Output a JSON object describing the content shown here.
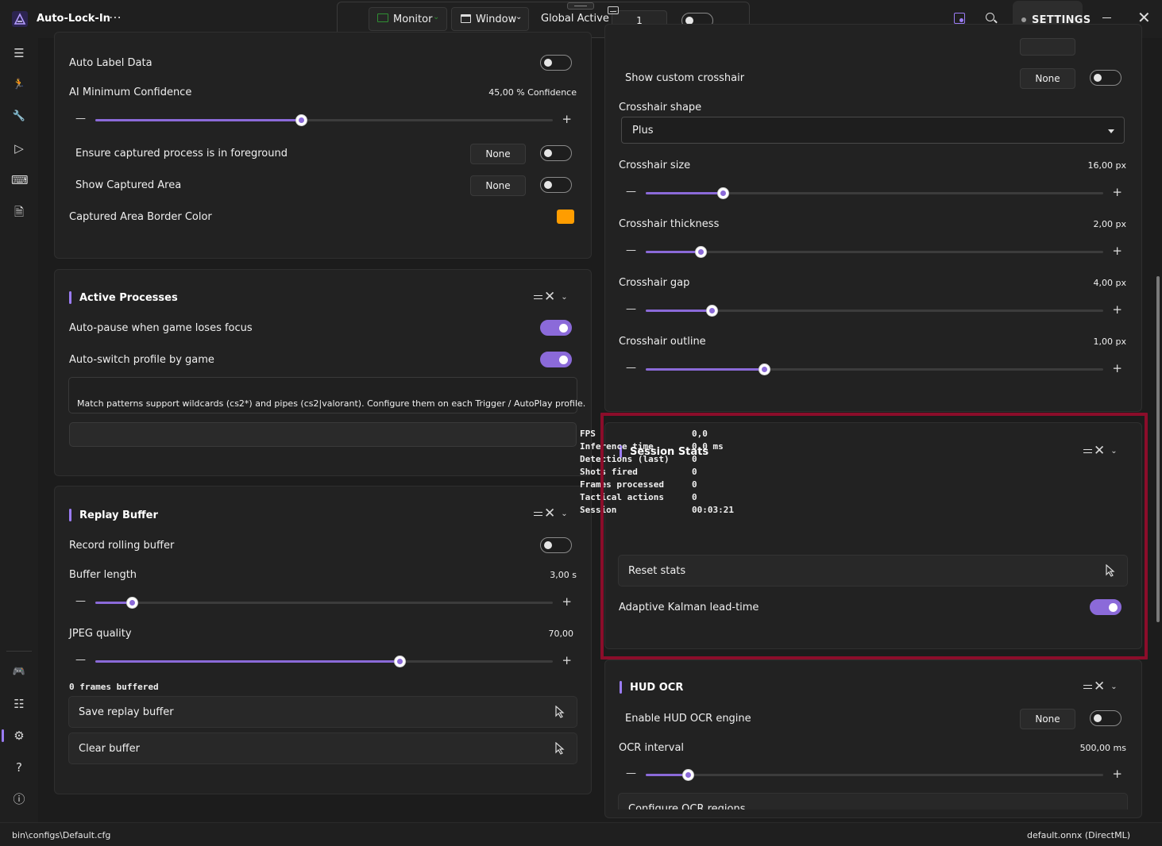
{
  "titlebar": {
    "app_title": "Auto-Lock-In",
    "menu_glyph": "⋯",
    "monitor_label": "Monitor",
    "window_label": "Window",
    "global_label": "Global Active",
    "global_value": "1",
    "settings_label": "SETTINGS",
    "minimize_glyph": "—",
    "close_glyph": "✕"
  },
  "sidebar": {
    "items": [
      {
        "name": "menu-icon",
        "glyph": "☰"
      },
      {
        "name": "running-figure-icon",
        "glyph": "🏃"
      },
      {
        "name": "wrench-icon",
        "glyph": "🔧"
      },
      {
        "name": "play-icon",
        "glyph": "▷"
      },
      {
        "name": "keyboard-icon",
        "glyph": "⌨"
      },
      {
        "name": "document-gear-icon",
        "glyph": "🗎"
      },
      {
        "name": "gamepad-icon",
        "glyph": "🎮"
      },
      {
        "name": "checklist-icon",
        "glyph": "☷"
      },
      {
        "name": "settings-gear-icon",
        "glyph": "⚙"
      },
      {
        "name": "help-icon",
        "glyph": "?"
      },
      {
        "name": "info-icon",
        "glyph": "ⓘ"
      }
    ]
  },
  "left": {
    "auto_label": "Auto Label Data",
    "ai_conf_label": "AI Minimum Confidence",
    "ai_conf_value": "45,00 % Confidence",
    "ai_conf_fraction": 0.45,
    "ensure_label": "Ensure captured process is in foreground",
    "ensure_hotkey": "None",
    "show_area_label": "Show Captured Area",
    "show_area_hotkey": "None",
    "border_color_label": "Captured Area Border Color",
    "border_color": "#ff9d00",
    "active_processes": {
      "title": "Active Processes",
      "auto_pause_label": "Auto-pause when game loses focus",
      "auto_switch_label": "Auto-switch profile by game",
      "info": "Match patterns support wildcards (cs2*) and pipes (cs2|valorant). Configure them on each Trigger / AutoPlay profile."
    },
    "replay": {
      "title": "Replay Buffer",
      "record_label": "Record rolling buffer",
      "buffer_length_label": "Buffer length",
      "buffer_length_value": "3,00 s",
      "buffer_fraction": 0.08,
      "jpeg_label": "JPEG quality",
      "jpeg_value": "70,00",
      "jpeg_fraction": 0.665,
      "frames_buffered": "0 frames buffered",
      "save_label": "Save replay buffer",
      "clear_label": "Clear buffer"
    }
  },
  "right": {
    "custom_crosshair_label": "Show custom crosshair",
    "custom_crosshair_hotkey": "None",
    "shape_label": "Crosshair shape",
    "shape_value": "Plus",
    "size_label": "Crosshair size",
    "size_value": "16,00 px",
    "size_fraction": 0.168,
    "thickness_label": "Crosshair thickness",
    "thickness_value": "2,00 px",
    "thickness_fraction": 0.12,
    "gap_label": "Crosshair gap",
    "gap_value": "4,00 px",
    "gap_fraction": 0.144,
    "outline_label": "Crosshair outline",
    "outline_value": "1,00 px",
    "outline_fraction": 0.258,
    "session": {
      "title": "Session Stats",
      "stats": [
        {
          "k": "FPS",
          "v": "0,0"
        },
        {
          "k": "Inference time",
          "v": "0,0 ms"
        },
        {
          "k": "Detections (last)",
          "v": "0"
        },
        {
          "k": "Shots fired",
          "v": "0"
        },
        {
          "k": "Frames processed",
          "v": "0"
        },
        {
          "k": "Tactical actions",
          "v": "0"
        },
        {
          "k": "Session",
          "v": "00:03:21"
        }
      ],
      "reset_label": "Reset stats",
      "kalman_label": "Adaptive Kalman lead-time"
    },
    "hud": {
      "title": "HUD OCR",
      "enable_label": "Enable HUD OCR engine",
      "enable_hotkey": "None",
      "interval_label": "OCR interval",
      "interval_value": "500,00 ms",
      "interval_fraction": 0.092,
      "configure_label": "Configure OCR regions"
    }
  },
  "status": {
    "config_path": "bin\\configs\\Default.cfg",
    "model": "default.onnx (DirectML)"
  },
  "colors": {
    "accent": "#8b6ad9",
    "highlight": "#8b0d2a",
    "monitor_green": "#2f8f33"
  }
}
